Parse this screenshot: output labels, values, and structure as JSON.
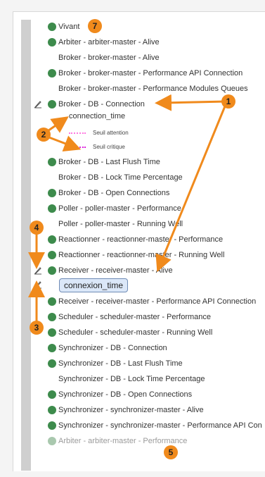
{
  "colors": {
    "ok": "#3d8b4c",
    "critical": "#cc3a2a",
    "unknown": "#666666",
    "warning": "#e89b1c",
    "annotation": "#f08a1c",
    "chip_bg": "#dbe7f8"
  },
  "services": [
    {
      "label": "Vivant",
      "status": "ok"
    },
    {
      "label": "Arbiter - arbiter-master - Alive",
      "status": "ok"
    },
    {
      "label": "Broker - broker-master - Alive",
      "status": "critical"
    },
    {
      "label": "Broker - broker-master - Performance API Connection",
      "status": "ok"
    },
    {
      "label": "Broker - broker-master - Performance Modules Queues",
      "status": "critical"
    },
    {
      "label": "Broker - DB - Connection",
      "status": "ok",
      "has_plot_icon": true
    },
    {
      "label": "Broker - DB - Last Flush Time",
      "status": "ok"
    },
    {
      "label": "Broker - DB - Lock Time Percentage",
      "status": "unknown"
    },
    {
      "label": "Broker - DB - Open Connections",
      "status": "ok"
    },
    {
      "label": "Poller - poller-master - Performance",
      "status": "ok"
    },
    {
      "label": "Poller - poller-master - Running Well",
      "status": "warning"
    },
    {
      "label": "Reactionner - reactionner-master - Performance",
      "status": "ok"
    },
    {
      "label": "Reactionner - reactionner-master - Running Well",
      "status": "ok"
    },
    {
      "label": "Receiver - receiver-master - Alive",
      "status": "ok",
      "has_plot_icon": true
    },
    {
      "label": "Receiver - receiver-master - Performance API Connection",
      "status": "ok"
    },
    {
      "label": "Scheduler - scheduler-master - Performance",
      "status": "ok"
    },
    {
      "label": "Scheduler - scheduler-master - Running Well",
      "status": "ok"
    },
    {
      "label": "Synchronizer - DB - Connection",
      "status": "ok"
    },
    {
      "label": "Synchronizer - DB - Last Flush Time",
      "status": "ok"
    },
    {
      "label": "Synchronizer - DB - Lock Time Percentage",
      "status": "unknown"
    },
    {
      "label": "Synchronizer - DB - Open Connections",
      "status": "ok"
    },
    {
      "label": "Synchronizer - synchronizer-master - Alive",
      "status": "ok"
    },
    {
      "label": "Synchronizer - synchronizer-master - Performance API Con",
      "status": "ok"
    },
    {
      "label": "Arbiter - arbiter-master - Performance",
      "status": "faded"
    }
  ],
  "metric": {
    "name": "connection_time",
    "legend_warning": "Seuil attention",
    "legend_critical": "Seuil critique"
  },
  "dropped_metric": {
    "label": "connexion_time"
  },
  "annotations": {
    "badge1": "1",
    "badge2": "2",
    "badge3": "3",
    "badge4": "4",
    "badge5": "5",
    "badge7": "7"
  },
  "icons": {
    "status": "check-circle-icon",
    "plot": "plot-tool-icon"
  }
}
